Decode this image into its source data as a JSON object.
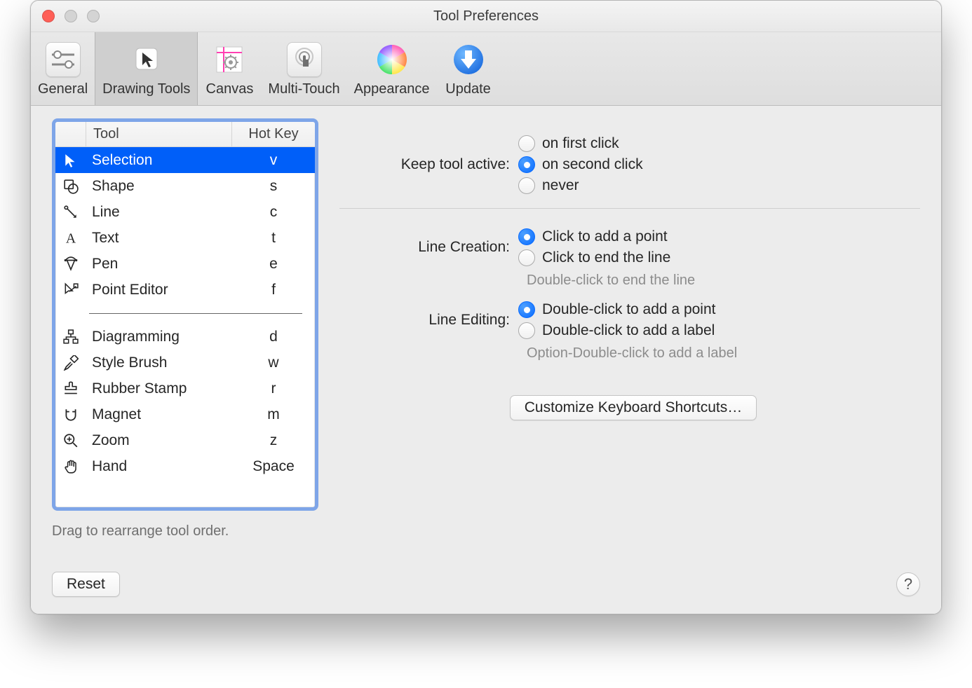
{
  "window": {
    "title": "Tool Preferences"
  },
  "toolbar": {
    "tabs": [
      {
        "id": "general",
        "label": "General"
      },
      {
        "id": "drawing-tools",
        "label": "Drawing Tools"
      },
      {
        "id": "canvas",
        "label": "Canvas"
      },
      {
        "id": "multi-touch",
        "label": "Multi-Touch"
      },
      {
        "id": "appearance",
        "label": "Appearance"
      },
      {
        "id": "update",
        "label": "Update"
      }
    ],
    "active": "drawing-tools"
  },
  "tool_table": {
    "headers": {
      "tool": "Tool",
      "hotkey": "Hot Key"
    },
    "selected_index": 0,
    "groups": [
      [
        {
          "name": "Selection",
          "key": "v",
          "icon": "cursor"
        },
        {
          "name": "Shape",
          "key": "s",
          "icon": "shape"
        },
        {
          "name": "Line",
          "key": "c",
          "icon": "line"
        },
        {
          "name": "Text",
          "key": "t",
          "icon": "text"
        },
        {
          "name": "Pen",
          "key": "e",
          "icon": "pen"
        },
        {
          "name": "Point Editor",
          "key": "f",
          "icon": "point"
        }
      ],
      [
        {
          "name": "Diagramming",
          "key": "d",
          "icon": "diagram"
        },
        {
          "name": "Style Brush",
          "key": "w",
          "icon": "brush"
        },
        {
          "name": "Rubber Stamp",
          "key": "r",
          "icon": "stamp"
        },
        {
          "name": "Magnet",
          "key": "m",
          "icon": "magnet"
        },
        {
          "name": "Zoom",
          "key": "z",
          "icon": "zoom"
        },
        {
          "name": "Hand",
          "key": "Space",
          "icon": "hand"
        }
      ]
    ],
    "hint": "Drag to rearrange tool order."
  },
  "settings": {
    "keep_active": {
      "label": "Keep tool active:",
      "options": [
        "on first click",
        "on second click",
        "never"
      ],
      "selected": 1
    },
    "line_creation": {
      "label": "Line Creation:",
      "options": [
        "Click to add a point",
        "Click to end the line"
      ],
      "selected": 0,
      "note": "Double-click to end the line"
    },
    "line_editing": {
      "label": "Line Editing:",
      "options": [
        "Double-click to add a point",
        "Double-click to add a label"
      ],
      "selected": 0,
      "note": "Option-Double-click to add a label"
    },
    "customize_button": "Customize Keyboard Shortcuts…"
  },
  "buttons": {
    "reset": "Reset",
    "help": "?"
  }
}
